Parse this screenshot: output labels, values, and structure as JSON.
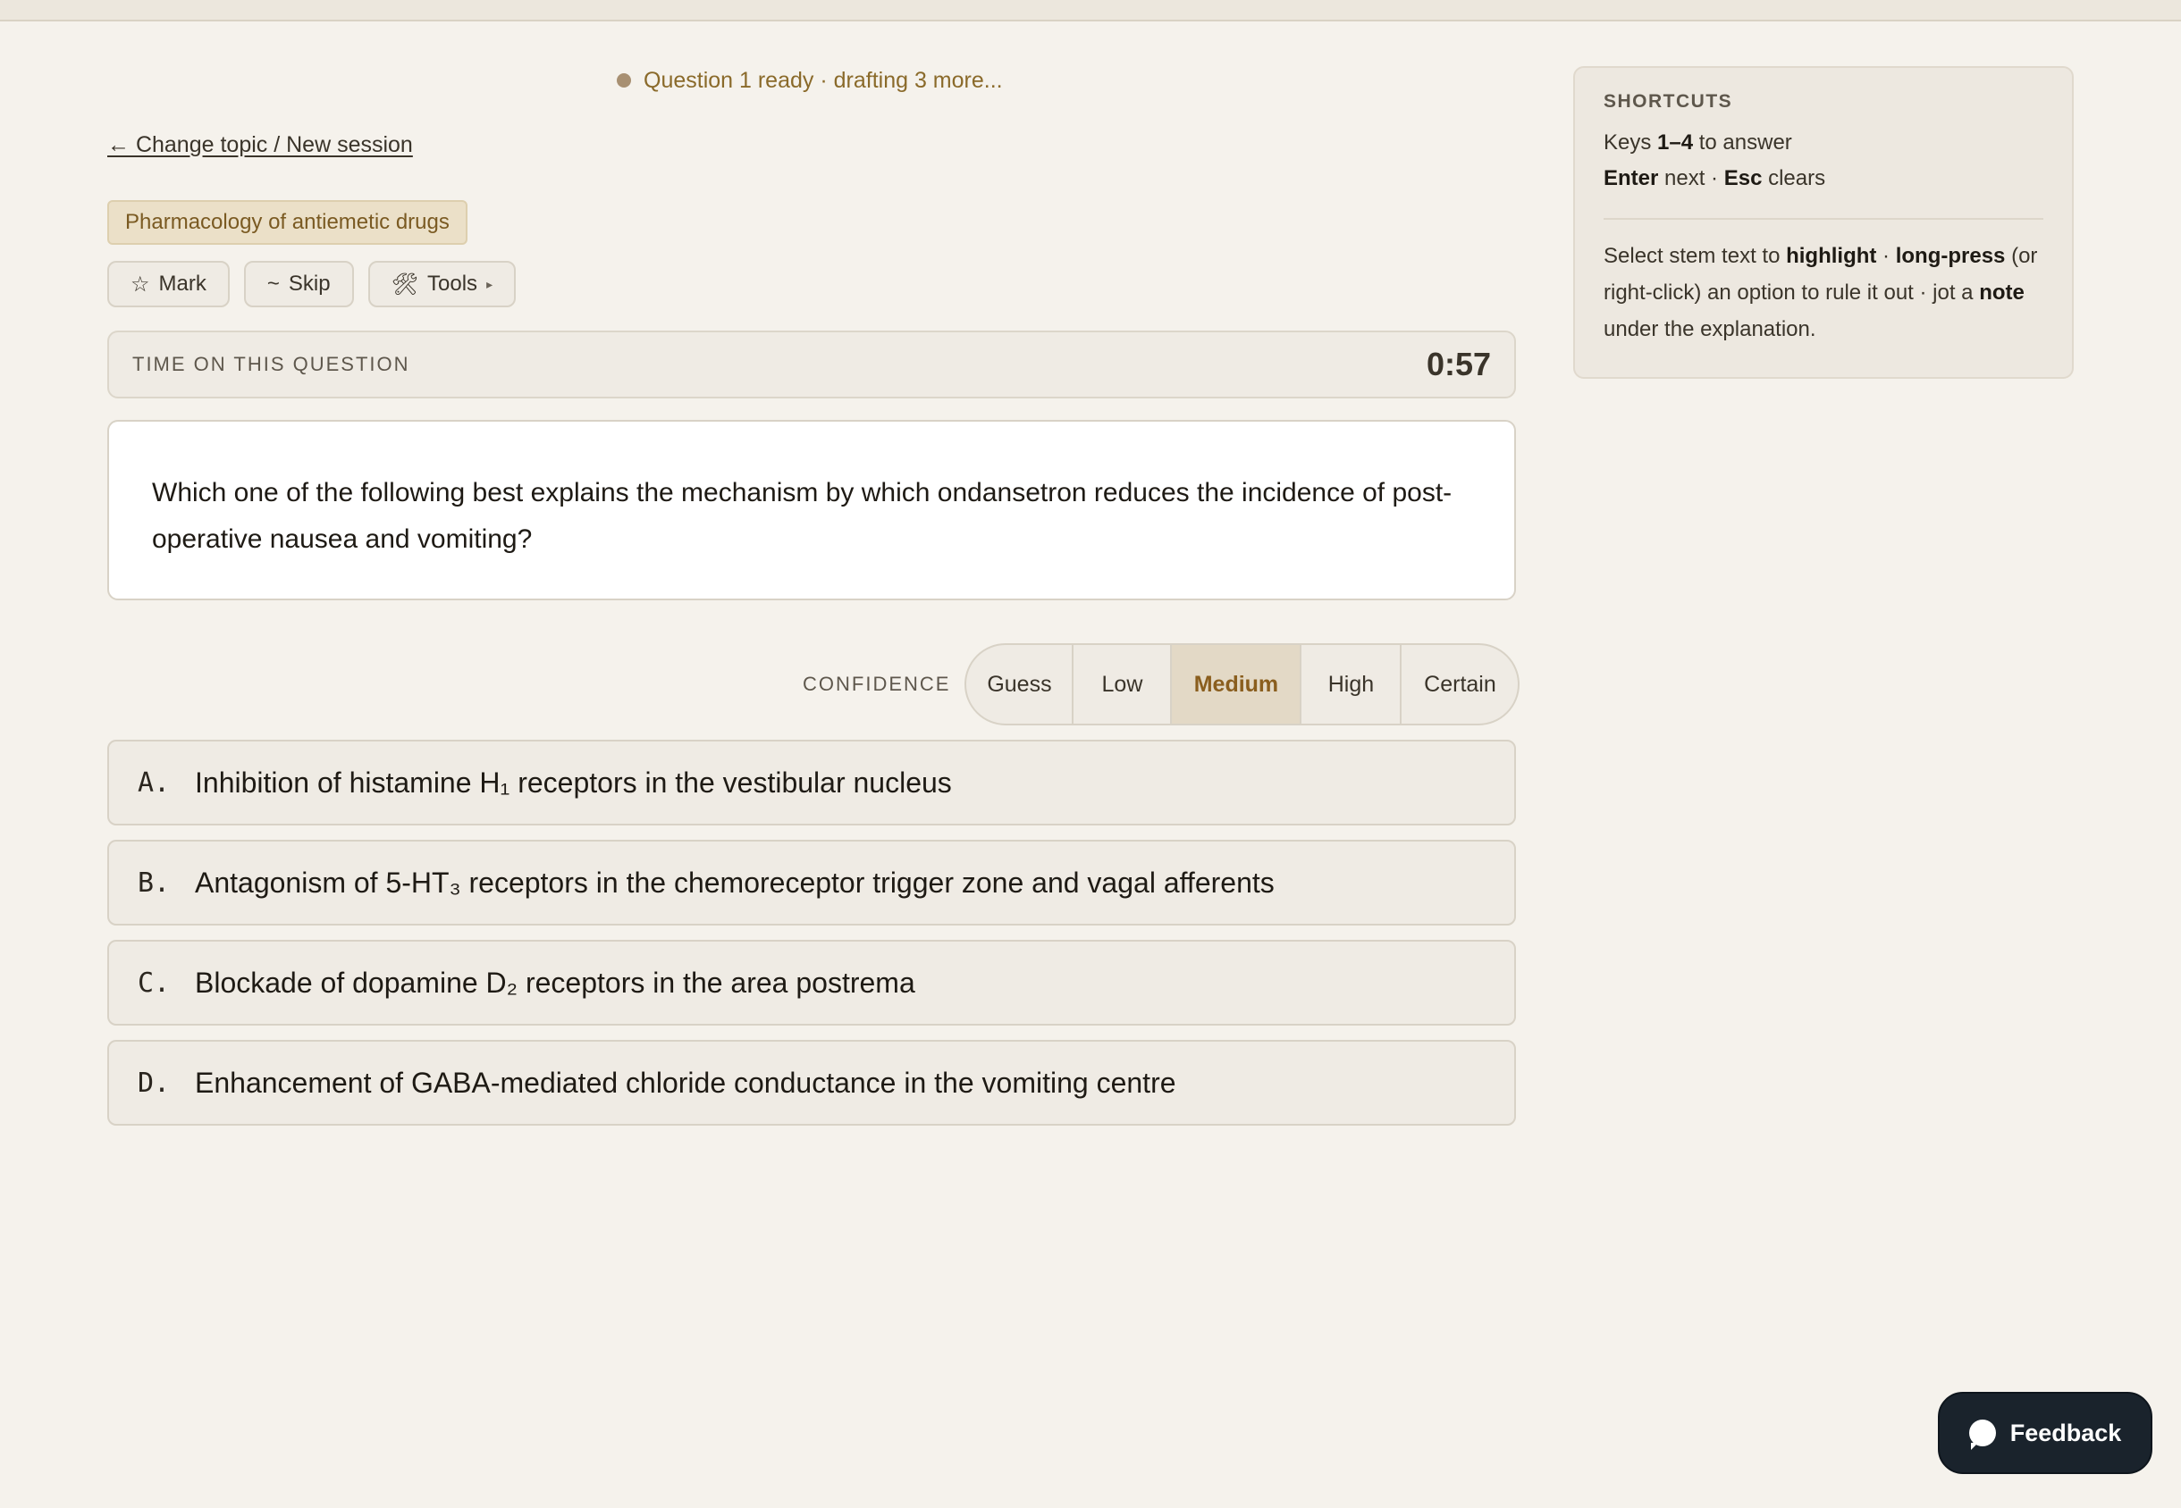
{
  "status": {
    "text": "Question 1 ready · drafting 3 more..."
  },
  "nav": {
    "back_link": "← Change topic / New session"
  },
  "topic": {
    "label": "Pharmacology of antiemetic drugs"
  },
  "tools": {
    "mark": {
      "icon": "☆",
      "label": "Mark"
    },
    "skip": {
      "icon": "~",
      "label": "Skip"
    },
    "tools": {
      "icon": "🛠",
      "label": "Tools",
      "caret": "▸"
    }
  },
  "timer": {
    "label": "TIME ON THIS QUESTION",
    "value": "0:57"
  },
  "question": {
    "stem": "Which one of the following best explains the mechanism by which ondansetron reduces the incidence of post-operative nausea and vomiting?"
  },
  "confidence": {
    "label": "CONFIDENCE",
    "options": [
      "Guess",
      "Low",
      "Medium",
      "High",
      "Certain"
    ],
    "selected": "Medium"
  },
  "answers": [
    {
      "letter": "A.",
      "text": "Inhibition of histamine H₁ receptors in the vestibular nucleus"
    },
    {
      "letter": "B.",
      "text": "Antagonism of 5-HT₃ receptors in the chemoreceptor trigger zone and vagal afferents"
    },
    {
      "letter": "C.",
      "text": "Blockade of dopamine D₂ receptors in the area postrema"
    },
    {
      "letter": "D.",
      "text": "Enhancement of GABA-mediated chloride conductance in the vomiting centre"
    }
  ],
  "shortcuts": {
    "title": "SHORTCUTS",
    "line1": {
      "pre": "Keys ",
      "keys": "1–4",
      "post": " to answer"
    },
    "line2": {
      "k1": "Enter",
      "mid": " next · ",
      "k2": "Esc",
      "post": " clears"
    },
    "para": {
      "t1": "Select stem text to ",
      "b1": "highlight",
      "t2": " · ",
      "b2": "long-press",
      "t3": " (or right-click) an option to rule it out · jot a ",
      "b3": "note",
      "t4": " under the explanation."
    }
  },
  "feedback": {
    "label": "Feedback"
  },
  "colors": {
    "background": "#f5f2ec",
    "accent": "#8a5e1e",
    "feedback_bg": "#1a232c"
  }
}
